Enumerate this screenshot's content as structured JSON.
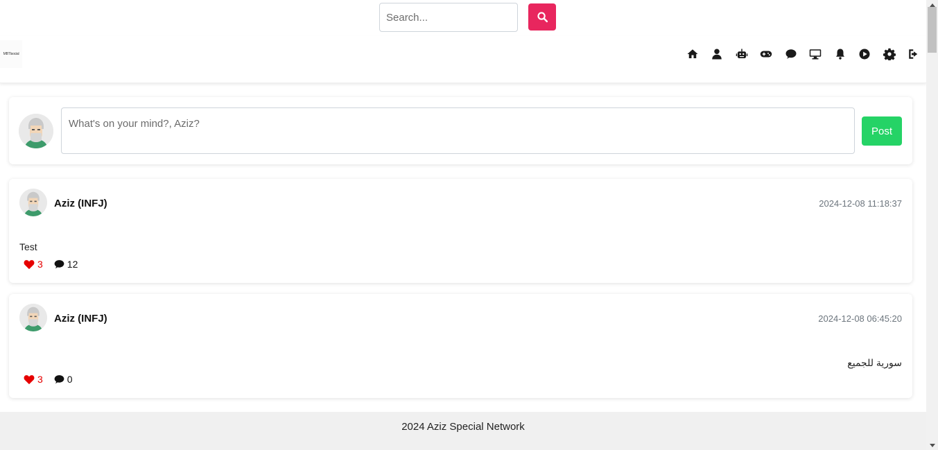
{
  "search": {
    "placeholder": "Search...",
    "button_icon": "search-icon"
  },
  "navbar": {
    "logo_text": "MBTIsocial",
    "icons": [
      "home-icon",
      "user-icon",
      "robot-icon",
      "gamepad-icon",
      "chat-icon",
      "desktop-icon",
      "bell-icon",
      "play-icon",
      "gear-icon",
      "sign-out-icon"
    ]
  },
  "composer": {
    "placeholder": "What's on your mind?, Aziz?",
    "post_label": "Post"
  },
  "posts": [
    {
      "author": "Aziz (INFJ)",
      "time": "2024-12-08 11:18:37",
      "text": "Test",
      "likes": "3",
      "comments": "12"
    },
    {
      "author": "Aziz (INFJ)",
      "time": "2024-12-08 06:45:20",
      "text": "سورية للجميع",
      "likes": "3",
      "comments": "0"
    }
  ],
  "footer": {
    "text": "2024 Aziz Special Network"
  },
  "colors": {
    "accent": "#e8265e",
    "post_button": "#25d366",
    "like": "#e60000"
  }
}
